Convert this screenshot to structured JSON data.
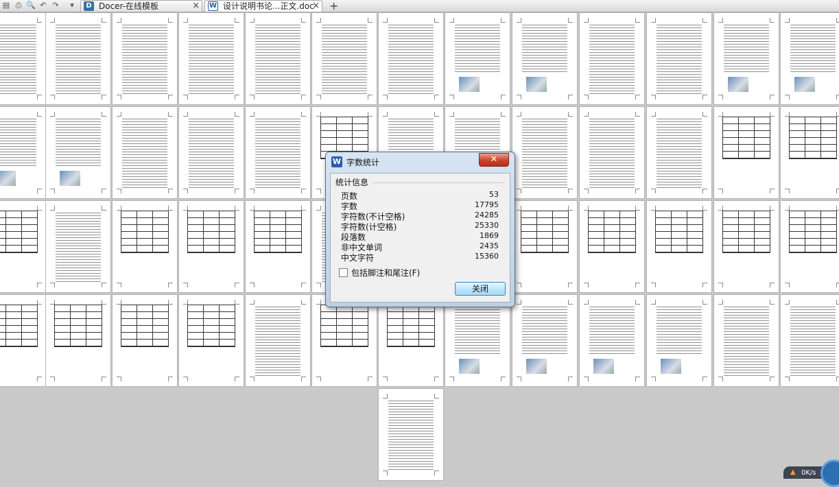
{
  "toolbar": {
    "icons": [
      "print-icon",
      "print-preview-icon",
      "undo-icon",
      "redo-icon",
      "more-icon"
    ]
  },
  "tabs": [
    {
      "logo": "D",
      "label": "Docer-在线模板",
      "close": "×"
    },
    {
      "logo": "W",
      "label": "设计说明书论...正文.doc",
      "close": "×"
    }
  ],
  "new_tab": "+",
  "pages": {
    "count": 53
  },
  "dialog": {
    "icon_letter": "W",
    "title": "字数统计",
    "close_glyph": "✕",
    "group_label": "统计信息",
    "stats": [
      {
        "label": "页数",
        "value": "53"
      },
      {
        "label": "字数",
        "value": "17795"
      },
      {
        "label": "字符数(不计空格)",
        "value": "24285"
      },
      {
        "label": "字符数(计空格)",
        "value": "25330"
      },
      {
        "label": "段落数",
        "value": "1869"
      },
      {
        "label": "非中文单词",
        "value": "2435"
      },
      {
        "label": "中文字符",
        "value": "15360"
      }
    ],
    "checkbox_label": "包括脚注和尾注(F)",
    "button_label": "关闭"
  },
  "status": {
    "speed": "0K/s"
  }
}
